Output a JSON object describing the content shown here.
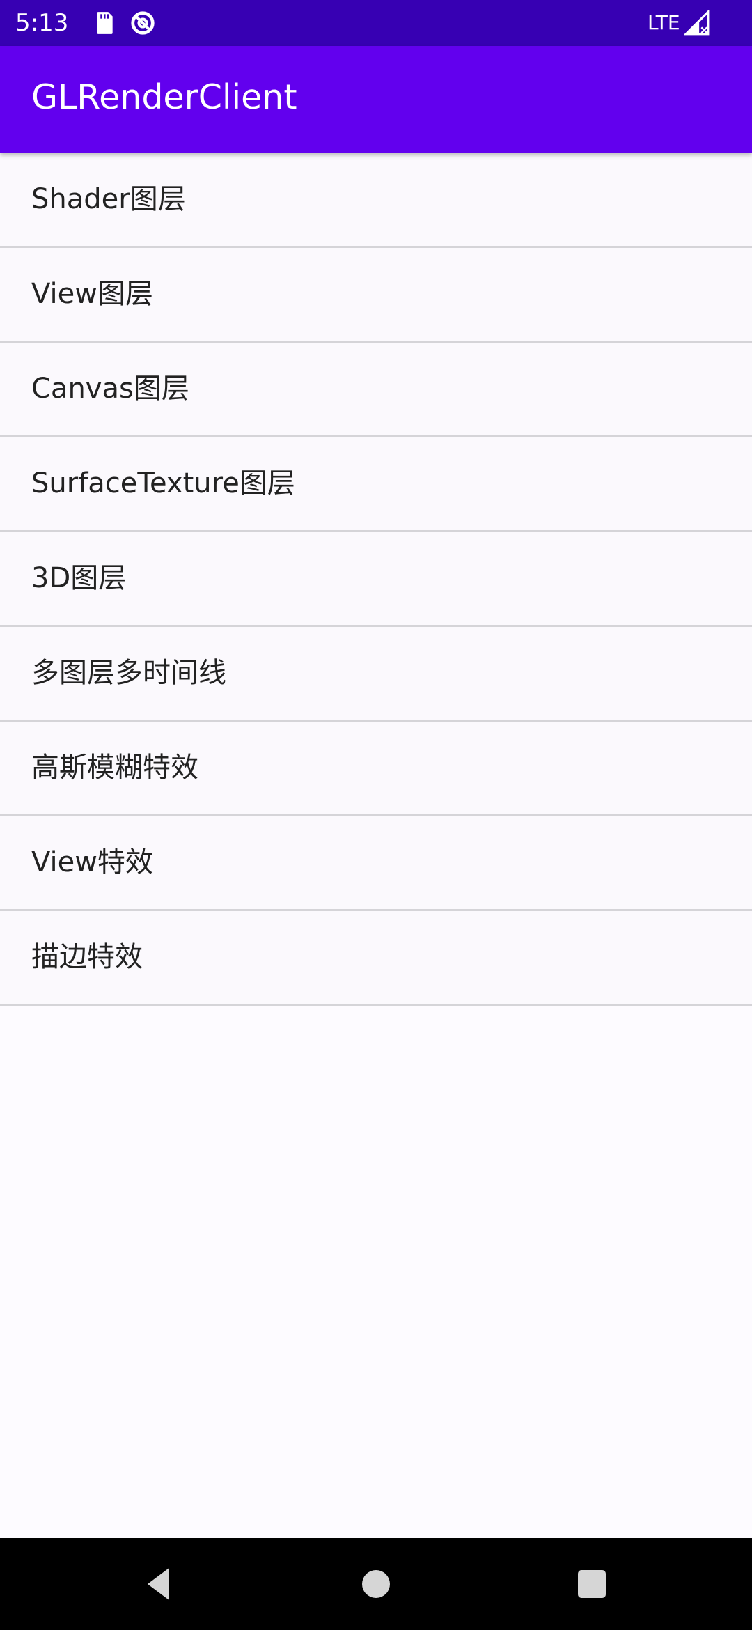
{
  "status_bar": {
    "time": "5:13",
    "network": "LTE",
    "icons": [
      "sd-card-icon",
      "do-not-disturb-icon",
      "signal-icon"
    ]
  },
  "app_bar": {
    "title": "GLRenderClient"
  },
  "list": {
    "items": [
      {
        "label": "Shader图层"
      },
      {
        "label": "View图层"
      },
      {
        "label": "Canvas图层"
      },
      {
        "label": "SurfaceTexture图层"
      },
      {
        "label": "3D图层"
      },
      {
        "label": "多图层多时间线"
      },
      {
        "label": "高斯模糊特效"
      },
      {
        "label": "View特效"
      },
      {
        "label": "描边特效"
      }
    ]
  },
  "nav_bar": {
    "buttons": [
      "back-icon",
      "home-icon",
      "recents-icon"
    ]
  },
  "colors": {
    "status_bar": "#3700b3",
    "app_bar": "#6200ee",
    "background": "#fdfbff",
    "divider": "#d5d4d8"
  }
}
